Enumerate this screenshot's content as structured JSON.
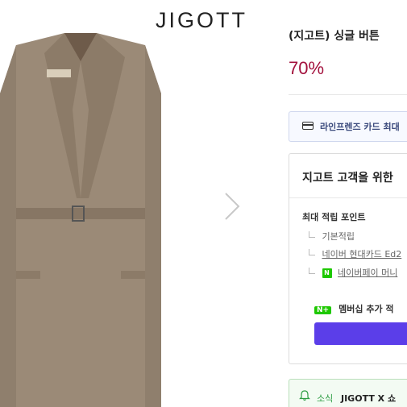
{
  "brand": {
    "name": "JIGOTT"
  },
  "product": {
    "title": "(지고트) 싱글 버튼",
    "discount": "70%"
  },
  "card_banner": {
    "text": "라인프렌즈 카드 최대"
  },
  "benefits": {
    "heading": "지고트 고객을 위한",
    "max_points_label": "최대 적립 포인트",
    "rows": [
      {
        "label": "기본적립",
        "linked": false
      },
      {
        "label": "네이버 현대카드 Ed2",
        "linked": true
      },
      {
        "label": "네이버페이 머니",
        "linked": true,
        "badge": "N"
      }
    ],
    "membership": {
      "badge": "N+",
      "text": "멤버십 추가 적"
    }
  },
  "alert": {
    "prefix": "소식",
    "brand": "JIGOTT X 쇼"
  },
  "icons": {
    "next": "chevron-right-icon",
    "card": "credit-card-icon",
    "bell": "bell-icon"
  },
  "colors": {
    "discount": "#a3113d",
    "naver_green": "#1ec800",
    "button_purple": "#5b3ee9"
  }
}
